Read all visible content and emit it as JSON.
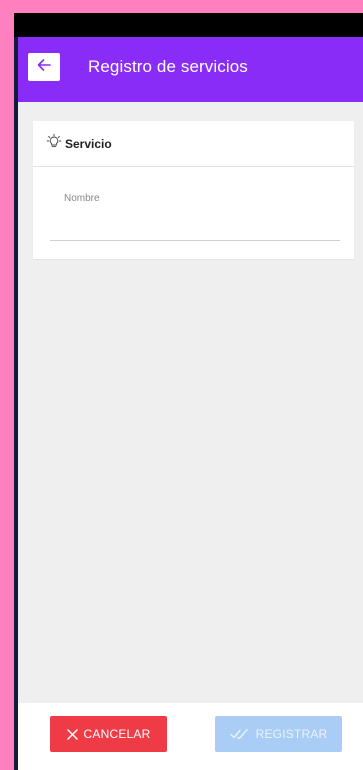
{
  "appbar": {
    "title": "Registro de servicios",
    "back_icon": "arrow-left-icon",
    "color": "#8a2cf7"
  },
  "card": {
    "icon": "lightbulb-icon",
    "title": "Servicio",
    "field": {
      "label": "Nombre",
      "value": ""
    }
  },
  "footer": {
    "cancel_label": "CANCELAR",
    "cancel_icon": "close-icon",
    "cancel_color": "#ef3b45",
    "register_label": "REGISTRAR",
    "register_icon": "double-check-icon",
    "register_color": "#a9cdf5"
  }
}
